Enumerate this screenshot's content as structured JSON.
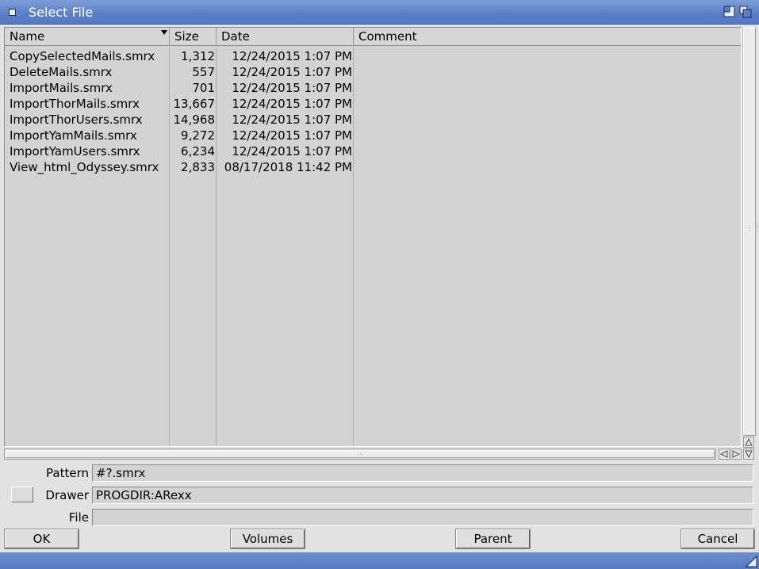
{
  "window": {
    "title": "Select File"
  },
  "list": {
    "columns": {
      "name": "Name",
      "size": "Size",
      "date": "Date",
      "comment": "Comment"
    },
    "rows": [
      {
        "name": "CopySelectedMails.smrx",
        "size": "1,312",
        "date": "12/24/2015 1:07 PM"
      },
      {
        "name": "DeleteMails.smrx",
        "size": "557",
        "date": "12/24/2015 1:07 PM"
      },
      {
        "name": "ImportMails.smrx",
        "size": "701",
        "date": "12/24/2015 1:07 PM"
      },
      {
        "name": "ImportThorMails.smrx",
        "size": "13,667",
        "date": "12/24/2015 1:07 PM"
      },
      {
        "name": "ImportThorUsers.smrx",
        "size": "14,968",
        "date": "12/24/2015 1:07 PM"
      },
      {
        "name": "ImportYamMails.smrx",
        "size": "9,272",
        "date": "12/24/2015 1:07 PM"
      },
      {
        "name": "ImportYamUsers.smrx",
        "size": "6,234",
        "date": "12/24/2015 1:07 PM"
      },
      {
        "name": "View_html_Odyssey.smrx",
        "size": "2,833",
        "date": "08/17/2018 11:42 PM"
      }
    ]
  },
  "form": {
    "pattern_label": "Pattern",
    "pattern_value": "#?.smrx",
    "drawer_label": "Drawer",
    "drawer_value": "PROGDIR:ARexx",
    "file_label": "File",
    "file_value": ""
  },
  "buttons": {
    "ok": "OK",
    "volumes": "Volumes",
    "parent": "Parent",
    "cancel": "Cancel"
  }
}
